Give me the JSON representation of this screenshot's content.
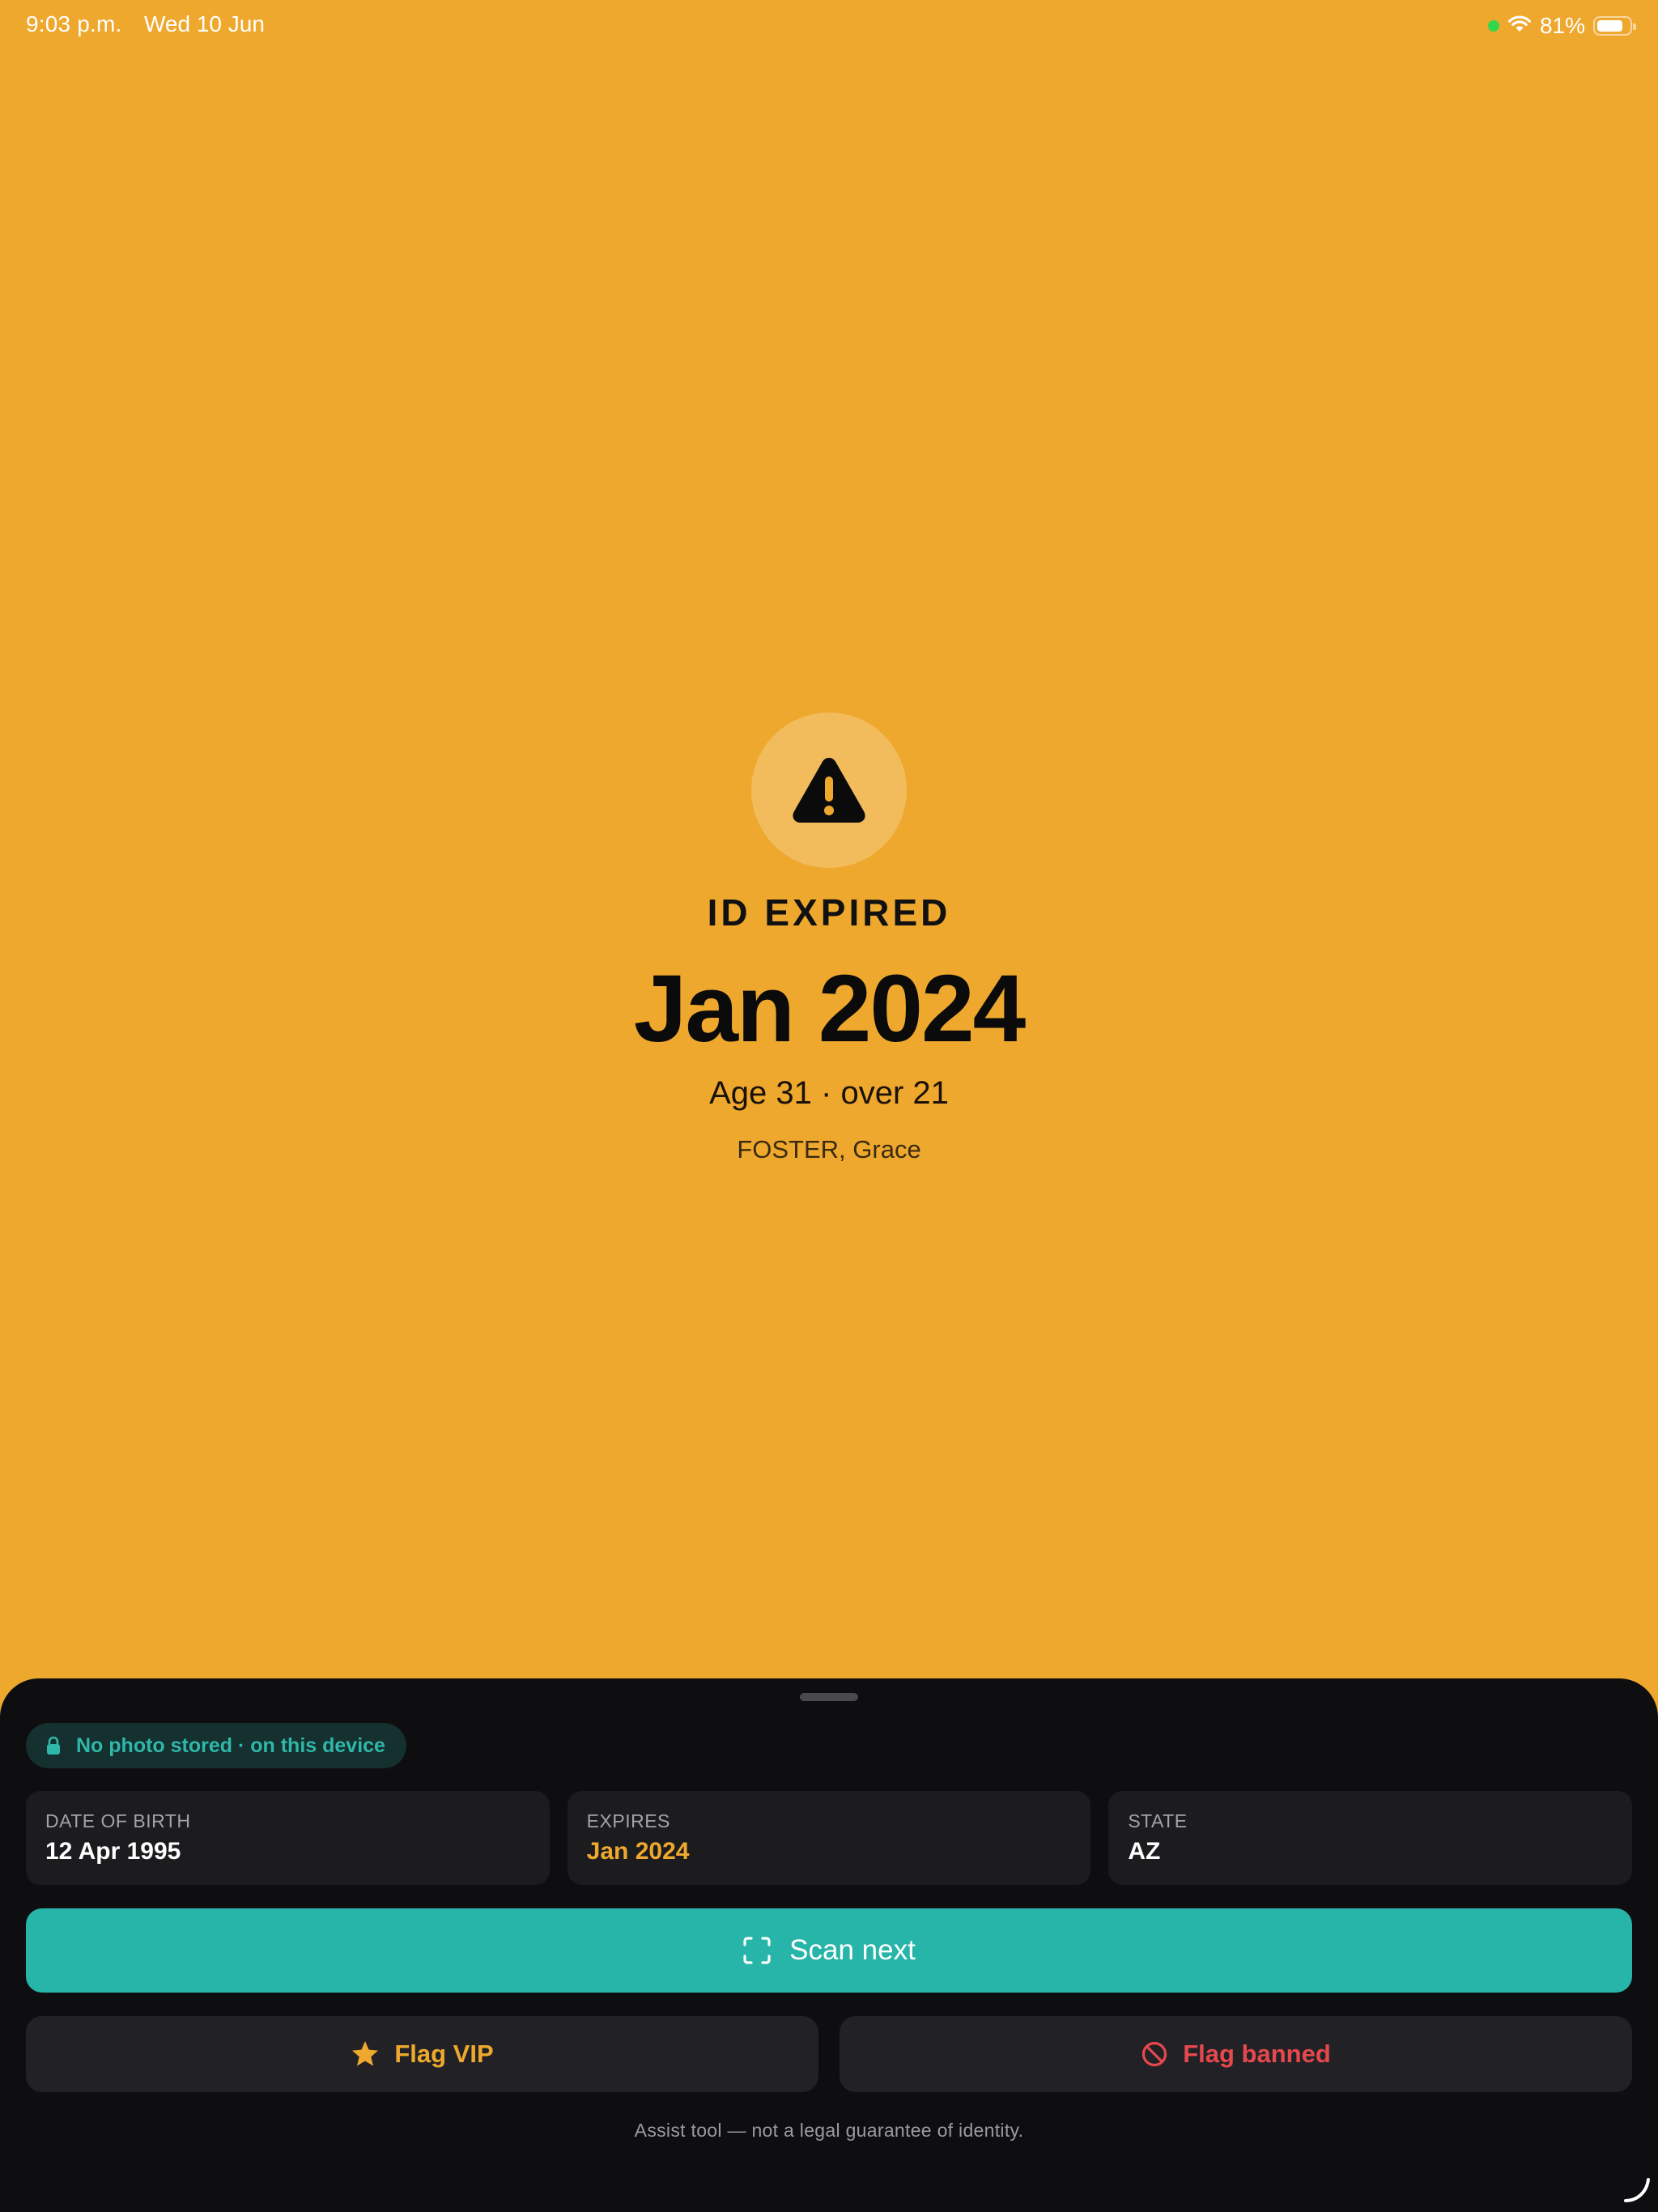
{
  "status_bar": {
    "time": "9:03 p.m.",
    "date": "Wed 10 Jun",
    "battery": "81%",
    "battery_level": 0.81
  },
  "result": {
    "icon": "warning-triangle-icon",
    "status_label": "ID EXPIRED",
    "expiry_headline": "Jan 2024",
    "age_line": "Age 31 · over 21",
    "holder_name": "FOSTER, Grace"
  },
  "sheet": {
    "privacy_badge": "No photo stored · on this device",
    "fields": [
      {
        "label": "DATE OF BIRTH",
        "value": "12 Apr 1995"
      },
      {
        "label": "EXPIRES",
        "value": "Jan 2024"
      },
      {
        "label": "STATE",
        "value": "AZ"
      }
    ],
    "scan_next_label": "Scan next",
    "flag_vip_label": "Flag VIP",
    "flag_banned_label": "Flag banned",
    "disclaimer": "Assist tool — not a legal guarantee of identity."
  },
  "colors": {
    "background": "#EFA82E",
    "sheet": "#0E0E10",
    "accent_teal": "#27B5AA",
    "warning_amber": "#EFA82E",
    "danger_red": "#E5484D"
  }
}
